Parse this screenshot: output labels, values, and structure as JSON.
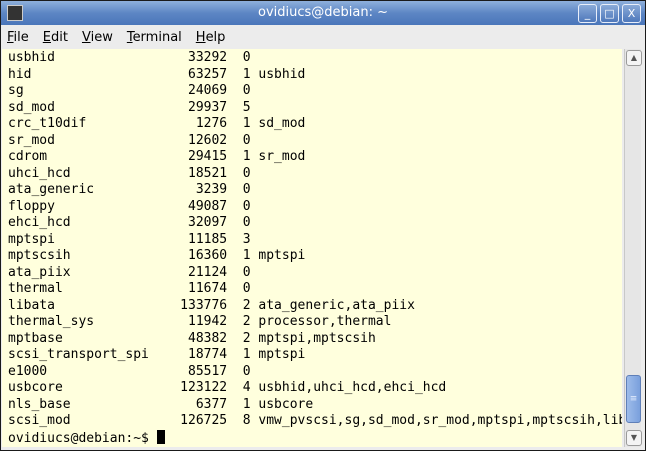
{
  "window": {
    "title": "ovidiucs@debian: ~",
    "minimize": "_",
    "maximize": "□",
    "close": "X"
  },
  "menu": [
    {
      "key": "F",
      "rest": "ile"
    },
    {
      "key": "E",
      "rest": "dit"
    },
    {
      "key": "V",
      "rest": "iew"
    },
    {
      "key": "T",
      "rest": "erminal"
    },
    {
      "key": "H",
      "rest": "elp"
    }
  ],
  "modules": [
    [
      "usbhid",
      "33292",
      "0",
      ""
    ],
    [
      "hid",
      "63257",
      "1",
      "usbhid"
    ],
    [
      "sg",
      "24069",
      "0",
      ""
    ],
    [
      "sd_mod",
      "29937",
      "5",
      ""
    ],
    [
      "crc_t10dif",
      "1276",
      "1",
      "sd_mod"
    ],
    [
      "sr_mod",
      "12602",
      "0",
      ""
    ],
    [
      "cdrom",
      "29415",
      "1",
      "sr_mod"
    ],
    [
      "uhci_hcd",
      "18521",
      "0",
      ""
    ],
    [
      "ata_generic",
      "3239",
      "0",
      ""
    ],
    [
      "floppy",
      "49087",
      "0",
      ""
    ],
    [
      "ehci_hcd",
      "32097",
      "0",
      ""
    ],
    [
      "mptspi",
      "11185",
      "3",
      ""
    ],
    [
      "mptscsih",
      "16360",
      "1",
      "mptspi"
    ],
    [
      "ata_piix",
      "21124",
      "0",
      ""
    ],
    [
      "thermal",
      "11674",
      "0",
      ""
    ],
    [
      "libata",
      "133776",
      "2",
      "ata_generic,ata_piix"
    ],
    [
      "thermal_sys",
      "11942",
      "2",
      "processor,thermal"
    ],
    [
      "mptbase",
      "48382",
      "2",
      "mptspi,mptscsih"
    ],
    [
      "scsi_transport_spi",
      "18774",
      "1",
      "mptspi"
    ],
    [
      "e1000",
      "85517",
      "0",
      ""
    ],
    [
      "usbcore",
      "123122",
      "4",
      "usbhid,uhci_hcd,ehci_hcd"
    ],
    [
      "nls_base",
      "6377",
      "1",
      "usbcore"
    ],
    [
      "scsi_mod",
      "126725",
      "8",
      "vmw_pvscsi,sg,sd_mod,sr_mod,mptspi,mptscsih,liba"
    ]
  ],
  "prompt": "ovidiucs@debian:~$ ",
  "scroll_position": 0.97
}
